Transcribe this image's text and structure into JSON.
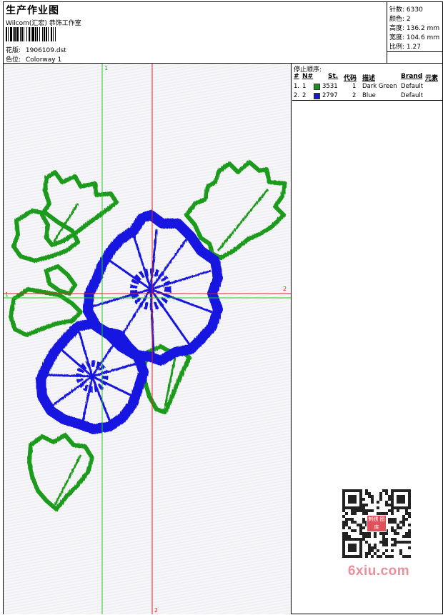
{
  "header": {
    "title": "生产作业图",
    "company": "Wilcom(汇宏) 恭饰工作室",
    "design_label": "花版:",
    "design_file": "1906109.dst",
    "colorway_label": "色位:",
    "colorway": "Colorway 1"
  },
  "stats": {
    "stitches_label": "针数:",
    "stitches": "6330",
    "colors_label": "颜色:",
    "colors": "2",
    "height_label": "高度:",
    "height": "136.2 mm",
    "width_label": "宽度:",
    "width": "104.6 mm",
    "scale_label": "比例:",
    "scale": "1.27"
  },
  "sequence": {
    "title": "停止顺序:",
    "columns": {
      "num": "#",
      "n": "N#",
      "st": "St.",
      "code": "代码",
      "desc": "描述",
      "brand": "Brand",
      "elem": "元素"
    },
    "rows": [
      {
        "num": "1.",
        "n": "1",
        "st": "3531",
        "code": "1",
        "desc": "Dark Green",
        "brand": "Default",
        "color": "#1f8f1f"
      },
      {
        "num": "2.",
        "n": "2",
        "st": "2797",
        "code": "2",
        "desc": "Blue",
        "brand": "Default",
        "color": "#1515d8"
      }
    ]
  },
  "guides": {
    "vertical_green_label": "1",
    "horizontal_green_label": "1",
    "horizontal_red_label": "2",
    "vertical_red_label": "2"
  },
  "colors": {
    "green": "#1f9a1f",
    "blue": "#1414e0",
    "guide_green": "#22cc22",
    "guide_red": "#dd2222"
  },
  "watermark": {
    "text": "6xiu.com",
    "stamp": "刺绣 图库"
  }
}
